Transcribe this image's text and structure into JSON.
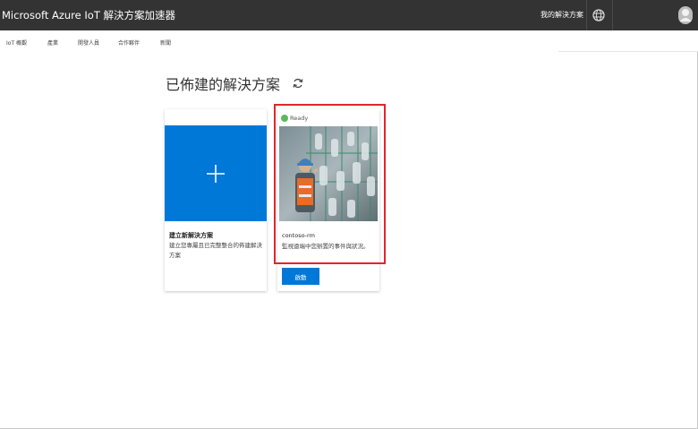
{
  "header": {
    "app_title": "Microsoft Azure IoT 解決方案加速器",
    "my_solutions": "我的解決方案",
    "globe_icon": "globe-icon",
    "user_icon": "user-avatar-icon"
  },
  "nav": {
    "items": [
      {
        "label": "IoT 概觀"
      },
      {
        "label": "產業"
      },
      {
        "label": "開發人員"
      },
      {
        "label": "合作夥伴"
      },
      {
        "label": "新聞"
      }
    ]
  },
  "main": {
    "title": "已佈建的解決方案",
    "refresh_icon": "refresh-icon"
  },
  "new_solution_card": {
    "plus_icon": "plus-icon",
    "title": "建立新解決方案",
    "description": "建立您專屬且已完整整合的佈建解決方案",
    "tile_color": "#0078d7"
  },
  "solution_card": {
    "status": "Ready",
    "status_color": "#5cb85c",
    "name": "contoso-rm",
    "description": "監視遠端中您辦置的事件與狀況。",
    "launch_label": "啟動",
    "highlight_color": "#e2262a"
  }
}
